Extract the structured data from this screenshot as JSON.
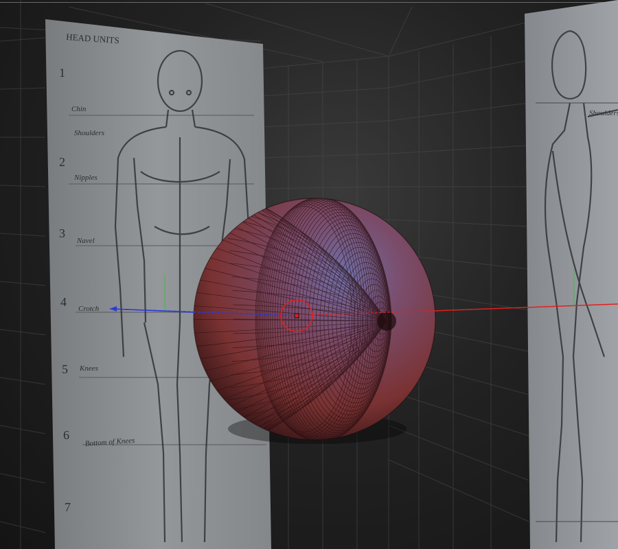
{
  "viewport": {
    "title": "",
    "background_color": "#1b1b1b",
    "grid_color": "#555555"
  },
  "reference_front": {
    "header": "HEAD UNITS",
    "unit_numbers": [
      "1",
      "2",
      "3",
      "4",
      "5",
      "6",
      "7"
    ],
    "landmarks": [
      "Chin",
      "Shoulders",
      "Nipples",
      "Navel",
      "Crotch",
      "Knees",
      "Bottom of Knees"
    ]
  },
  "reference_side": {
    "landmarks": [
      "Shoulders"
    ]
  },
  "sphere": {
    "color": "#8a3c3c",
    "highlight_color": "#6e6e9e",
    "wire_color": "#2a0f12"
  },
  "gizmo": {
    "x_axis_color": "#e02020",
    "z_axis_color": "#2a3ad8",
    "y_axis_color": "#30c030"
  }
}
